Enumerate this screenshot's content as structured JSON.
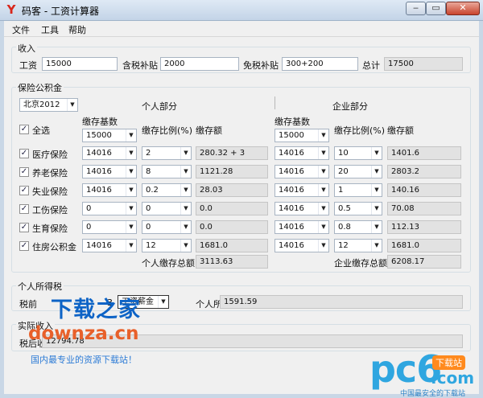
{
  "window": {
    "title": "码客 - 工资计算器",
    "app_icon_glyph": "Y",
    "buttons": [
      "minimize-icon",
      "maximize-icon",
      "close-icon"
    ]
  },
  "menu": [
    "文件",
    "工具",
    "帮助"
  ],
  "income": {
    "group_title": "收入",
    "salary_label": "工资",
    "salary_value": "15000",
    "taxed_allowance_label": "含税补贴",
    "taxed_allowance_value": "2000",
    "taxfree_allowance_label": "免税补贴",
    "taxfree_allowance_value": "300+200",
    "total_label": "总计",
    "total_value": "17500"
  },
  "insurance": {
    "group_title": "保险公积金",
    "city_selected": "北京2012",
    "personal_header": "个人部分",
    "company_header": "企业部分",
    "select_all_label": "全选",
    "col_base": "缴存基数",
    "col_ratio": "缴存比例(%)",
    "col_amount": "缴存额",
    "personal_base_default": "15000",
    "company_base_default": "15000",
    "rows": [
      {
        "label": "医疗保险",
        "p_base": "14016",
        "p_ratio": "2",
        "p_amount": "280.32 + 3",
        "c_base": "14016",
        "c_ratio": "10",
        "c_amount": "1401.6"
      },
      {
        "label": "养老保险",
        "p_base": "14016",
        "p_ratio": "8",
        "p_amount": "1121.28",
        "c_base": "14016",
        "c_ratio": "20",
        "c_amount": "2803.2"
      },
      {
        "label": "失业保险",
        "p_base": "14016",
        "p_ratio": "0.2",
        "p_amount": "28.03",
        "c_base": "14016",
        "c_ratio": "1",
        "c_amount": "140.16"
      },
      {
        "label": "工伤保险",
        "p_base": "0",
        "p_ratio": "0",
        "p_amount": "0.0",
        "c_base": "14016",
        "c_ratio": "0.5",
        "c_amount": "70.08"
      },
      {
        "label": "生育保险",
        "p_base": "0",
        "p_ratio": "0",
        "p_amount": "0.0",
        "c_base": "14016",
        "c_ratio": "0.8",
        "c_amount": "112.13"
      },
      {
        "label": "住房公积金",
        "p_base": "14016",
        "p_ratio": "12",
        "p_amount": "1681.0",
        "c_base": "14016",
        "c_ratio": "12",
        "c_amount": "1681.0"
      }
    ],
    "personal_total_label": "个人缴存总额",
    "personal_total_value": "3113.63",
    "company_total_label": "企业缴存总额",
    "company_total_value": "6208.17"
  },
  "tax": {
    "group_title": "个人所得税",
    "threshold_label_partial": "税前",
    "threshold_value_partial": "3",
    "type_selected": "工资薪金",
    "tax_label": "个人所得税",
    "tax_value": "1591.59"
  },
  "net": {
    "group_title": "实际收入",
    "label_partial": "税后收",
    "value_partial": "12794.78"
  },
  "watermark": {
    "site_cn": "下载之家",
    "site_url": "downza.cn",
    "site_slogan": "国内最专业的资源下载站！",
    "pc6_logo": "pc6",
    "pc6_badge": "下载站",
    "pc6_domain": ".com",
    "pc6_slogan": "中国最安全的下载站"
  }
}
